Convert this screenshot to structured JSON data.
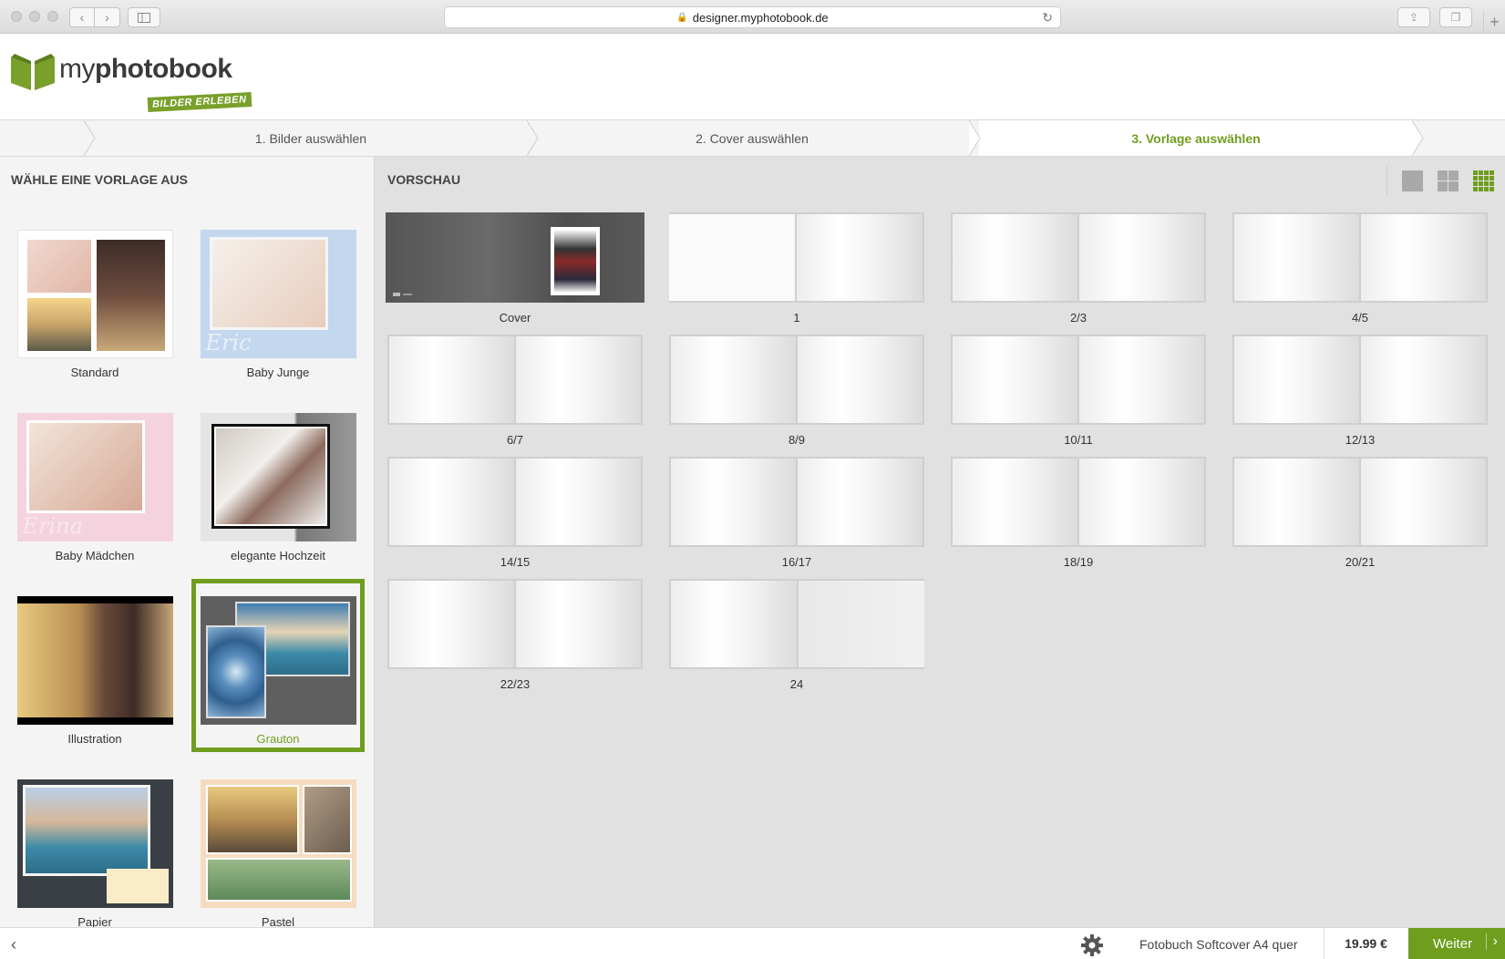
{
  "browser": {
    "url": "designer.myphotobook.de"
  },
  "logo": {
    "name_light": "my",
    "name_bold": "photobook",
    "tagline": "BILDER ERLEBEN"
  },
  "steps": [
    {
      "label": "1. Bilder auswählen"
    },
    {
      "label": "2. Cover auswählen"
    },
    {
      "label": "3. Vorlage auswählen"
    }
  ],
  "left_panel": {
    "title": "WÄHLE EINE VORLAGE AUS",
    "templates": [
      {
        "label": "Standard"
      },
      {
        "label": "Baby Junge"
      },
      {
        "label": "Baby Mädchen"
      },
      {
        "label": "elegante Hochzeit"
      },
      {
        "label": "Illustration"
      },
      {
        "label": "Grauton",
        "selected": true
      },
      {
        "label": "Papier"
      },
      {
        "label": "Pastel"
      }
    ]
  },
  "preview": {
    "title": "VORSCHAU",
    "view_icons": [
      "single-view-icon",
      "quad-view-icon",
      "grid-view-icon"
    ],
    "pages": [
      {
        "label": "Cover"
      },
      {
        "label": "1"
      },
      {
        "label": "2/3"
      },
      {
        "label": "4/5"
      },
      {
        "label": "6/7"
      },
      {
        "label": "8/9"
      },
      {
        "label": "10/11"
      },
      {
        "label": "12/13"
      },
      {
        "label": "14/15"
      },
      {
        "label": "16/17"
      },
      {
        "label": "18/19"
      },
      {
        "label": "20/21"
      },
      {
        "label": "22/23"
      },
      {
        "label": "24"
      }
    ]
  },
  "footer": {
    "product": "Fotobuch Softcover A4 quer",
    "price": "19.99 €",
    "next_label": "Weiter"
  },
  "colors": {
    "accent": "#6f9e1e"
  }
}
